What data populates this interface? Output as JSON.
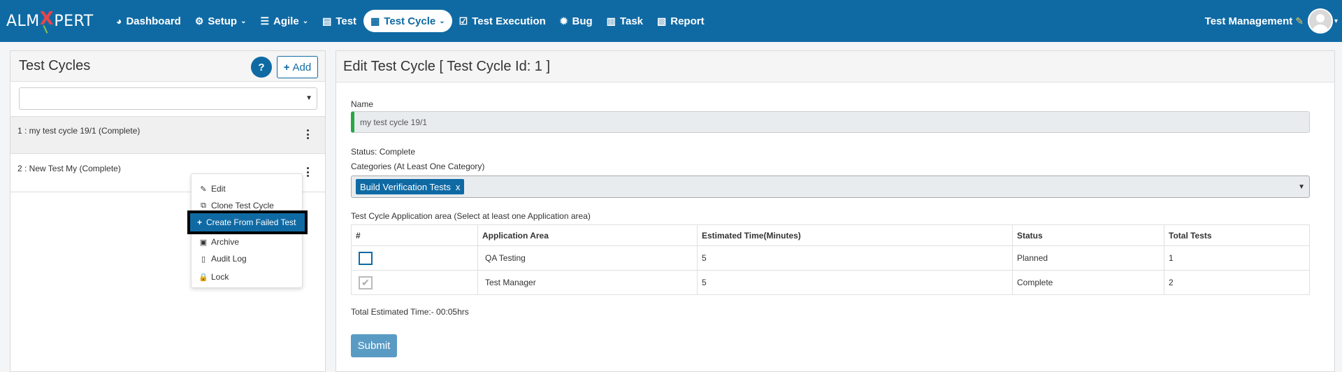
{
  "brand": {
    "logo_left": "ALM",
    "logo_x": "X",
    "logo_right": "PERT"
  },
  "nav": {
    "items": [
      {
        "label": "Dashboard",
        "icon": "dashboard-icon",
        "glyph": "◕"
      },
      {
        "label": "Setup",
        "icon": "gears-icon",
        "glyph": "⚙",
        "dropdown": true
      },
      {
        "label": "Agile",
        "icon": "list-icon",
        "glyph": "☰",
        "dropdown": true
      },
      {
        "label": "Test",
        "icon": "document-icon",
        "glyph": "▤"
      },
      {
        "label": "Test Cycle",
        "icon": "grid-icon",
        "glyph": "▦",
        "dropdown": true,
        "active": true
      },
      {
        "label": "Test Execution",
        "icon": "check-square-icon",
        "glyph": "☑"
      },
      {
        "label": "Bug",
        "icon": "bug-icon",
        "glyph": "✹"
      },
      {
        "label": "Task",
        "icon": "tasks-icon",
        "glyph": "▥"
      },
      {
        "label": "Report",
        "icon": "report-icon",
        "glyph": "▧"
      }
    ],
    "user_label": "Test Management"
  },
  "left": {
    "title": "Test Cycles",
    "add_label": "Add",
    "help_label": "?",
    "cycles": [
      {
        "text": "1 : my test cycle 19/1 (Complete)"
      },
      {
        "text": "2 : New Test My (Complete)"
      }
    ],
    "menu": {
      "edit": "Edit",
      "clone": "Clone Test Cycle",
      "create_failed": "Create From Failed Test",
      "archive": "Archive",
      "audit": "Audit Log",
      "lock": "Lock"
    }
  },
  "right": {
    "title": "Edit Test Cycle  [ Test Cycle Id: 1 ]",
    "name_label": "Name",
    "name_value": "my test cycle 19/1",
    "status_text": "Status: Complete",
    "categories_label": "Categories (At Least One Category)",
    "category_tag": "Build Verification Tests",
    "category_remove": "x",
    "area_label": "Test Cycle Application area (Select at least one Application area)",
    "table": {
      "headers": [
        "#",
        "Application Area",
        "Estimated Time(Minutes)",
        "Status",
        "Total Tests"
      ],
      "rows": [
        {
          "checked": false,
          "area": "QA Testing",
          "time": "5",
          "status": "Planned",
          "total": "1"
        },
        {
          "checked": true,
          "area": "Test Manager",
          "time": "5",
          "status": "Complete",
          "total": "2"
        }
      ]
    },
    "total_time": "Total Estimated Time:- 00:05hrs",
    "submit_label": "Submit"
  },
  "colors": {
    "primary": "#0f6aa4",
    "accent_green": "#28a745",
    "submit": "#5a9bc4"
  }
}
